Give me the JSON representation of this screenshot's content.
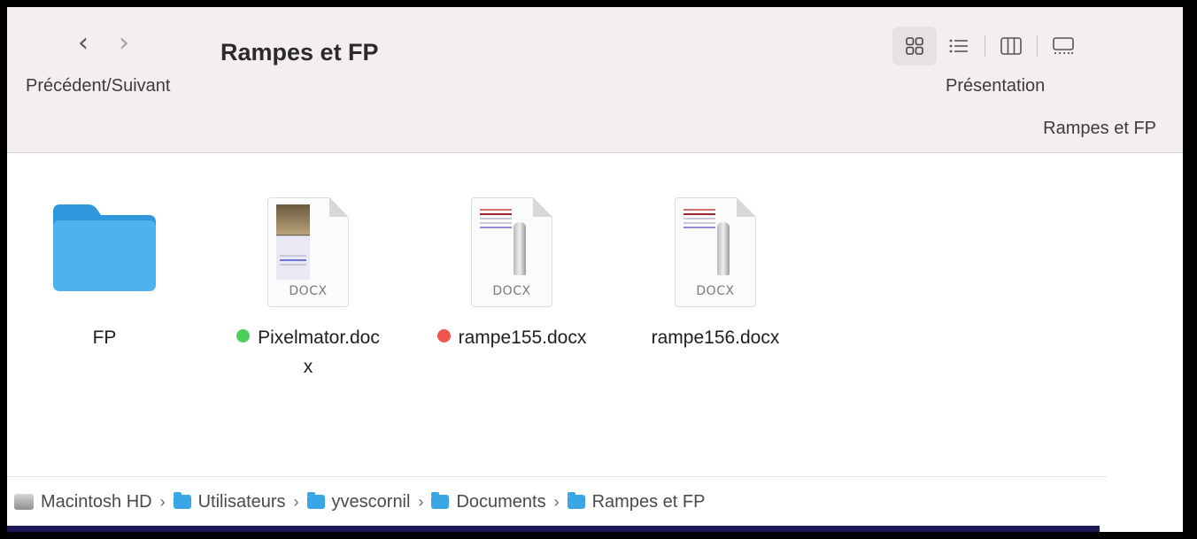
{
  "toolbar": {
    "back_icon": "chevron-left-icon",
    "forward_icon": "chevron-right-icon",
    "nav_label": "Précédent/Suivant",
    "title": "Rampes et FP",
    "view_label": "Présentation",
    "path_title": "Rampes et FP",
    "view_modes": [
      "icon-view-icon",
      "list-view-icon",
      "column-view-icon",
      "gallery-view-icon"
    ],
    "active_view": "icon-view-icon"
  },
  "items": [
    {
      "name": "FP",
      "line2": "",
      "kind": "folder",
      "tag_color": ""
    },
    {
      "name": "Pixelmator.doc",
      "line2": "x",
      "kind": "docx",
      "tag_color": "#4cd05a",
      "ext": "DOCX"
    },
    {
      "name": "rampe155.docx",
      "line2": "",
      "kind": "docx",
      "tag_color": "#f0564f",
      "ext": "DOCX"
    },
    {
      "name": "rampe156.docx",
      "line2": "",
      "kind": "docx",
      "tag_color": "",
      "ext": "DOCX"
    }
  ],
  "pathbar": {
    "crumbs": [
      "Macintosh HD",
      "Utilisateurs",
      "yvescornil",
      "Documents",
      "Rampes et FP"
    ]
  },
  "colors": {
    "toolbar_bg": "#f5eef1",
    "folder": "#3aa6e6",
    "tag_green": "#4cd05a",
    "tag_red": "#f0564f"
  }
}
